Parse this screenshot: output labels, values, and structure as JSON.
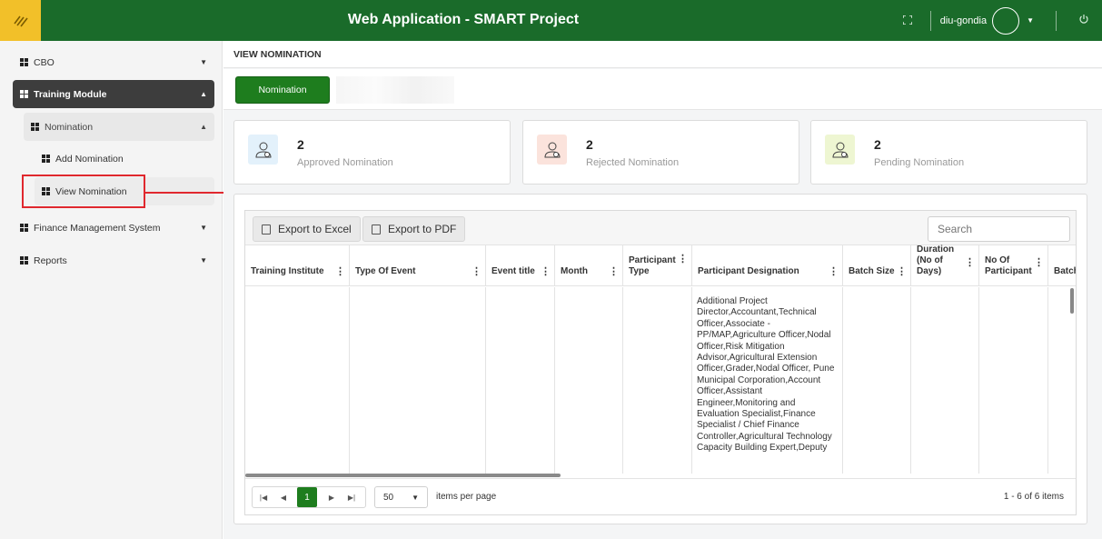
{
  "header": {
    "title": "Web Application - SMART Project",
    "username": "diu-gondia",
    "logo_icon": "menu-toggle-icon",
    "accent": "#1a6b2a",
    "logo_bg": "#f2c029"
  },
  "sidebar": {
    "items": [
      {
        "label": "CBO"
      },
      {
        "label": "Training Module"
      },
      {
        "label": "Nomination"
      },
      {
        "label": "Add Nomination"
      },
      {
        "label": "View Nomination"
      },
      {
        "label": "Finance Management System"
      },
      {
        "label": "Reports"
      }
    ]
  },
  "page": {
    "breadcrumb": "VIEW NOMINATION",
    "nomination_button": "Nomination"
  },
  "cards": [
    {
      "count": "2",
      "label": "Approved Nomination",
      "color": "#e3f1fb"
    },
    {
      "count": "2",
      "label": "Rejected Nomination",
      "color": "#fbe3dc"
    },
    {
      "count": "2",
      "label": "Pending Nomination",
      "color": "#eef6d2"
    }
  ],
  "grid": {
    "export_excel": "Export to Excel",
    "export_pdf": "Export to PDF",
    "search_placeholder": "Search",
    "columns": [
      "Training Institute",
      "Type Of Event",
      "Event title",
      "Month",
      "Participant Type",
      "Participant Designation",
      "Batch Size",
      "Duration (No of Days)",
      "No Of Participant",
      "Batch"
    ],
    "participant_designation": "Additional Project Director,Accountant,Technical Officer,Associate - PP/MAP,Agriculture Officer,Nodal Officer,Risk Mitigation Advisor,Agricultural Extension Officer,Grader,Nodal Officer, Pune Municipal Corporation,Account Officer,Assistant Engineer,Monitoring and Evaluation Specialist,Finance Specialist / Chief Finance Controller,Agricultural Technology Capacity Building Expert,Deputy",
    "pager": {
      "current_page": "1",
      "page_size": "50",
      "items_per_page": "items per page",
      "info": "1 - 6 of 6 items"
    }
  }
}
